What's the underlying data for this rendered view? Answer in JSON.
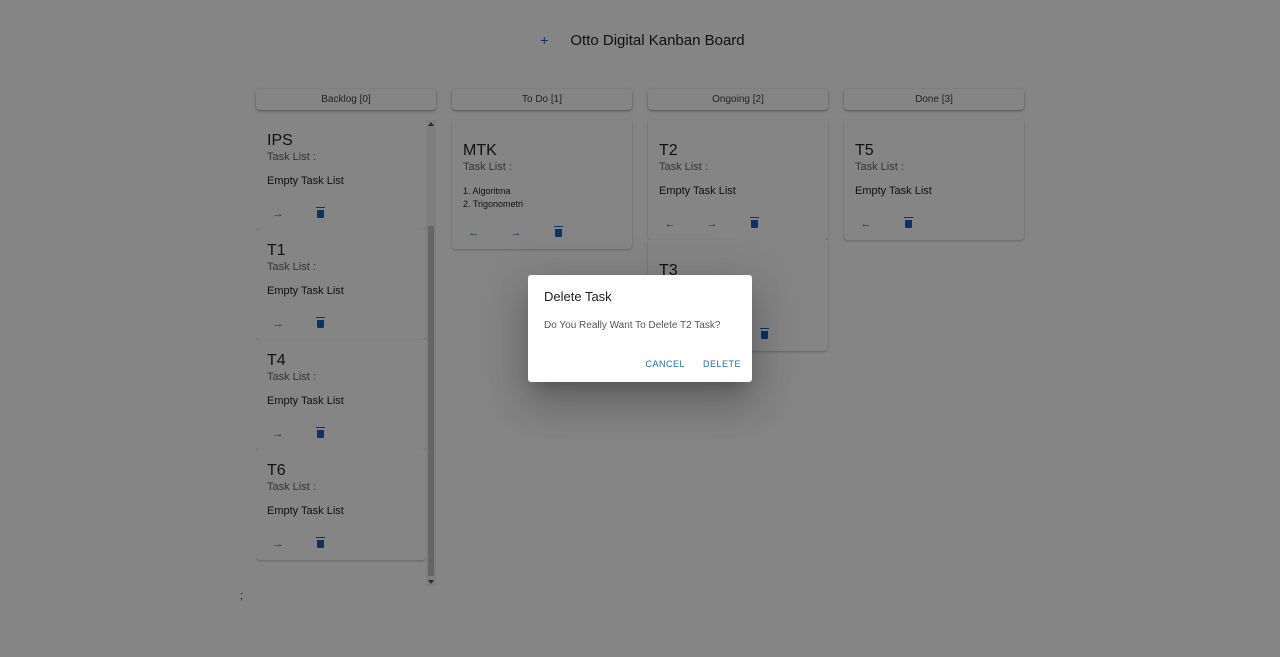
{
  "header": {
    "add_symbol": "+",
    "title": "Otto Digital Kanban Board"
  },
  "columns": [
    {
      "header": "Backlog [0]",
      "cards": [
        {
          "title": "IPS",
          "subtitle": "Task List :",
          "body": "Empty Task List",
          "actions": [
            "forward",
            "delete"
          ]
        },
        {
          "title": "T1",
          "subtitle": "Task List :",
          "body": "Empty Task List",
          "actions": [
            "forward",
            "delete"
          ]
        },
        {
          "title": "T4",
          "subtitle": "Task List :",
          "body": "Empty Task List",
          "actions": [
            "forward",
            "delete"
          ]
        },
        {
          "title": "T6",
          "subtitle": "Task List :",
          "body": "Empty Task List",
          "actions": [
            "forward",
            "delete"
          ]
        }
      ]
    },
    {
      "header": "To Do [1]",
      "cards": [
        {
          "title": "MTK",
          "subtitle": "Task List :",
          "tasks": [
            "1. Algoritma",
            "2. Trigonometri"
          ],
          "actions": [
            "back",
            "forward",
            "delete"
          ]
        }
      ]
    },
    {
      "header": "Ongoing [2]",
      "cards": [
        {
          "title": "T2",
          "subtitle": "Task List :",
          "body": "Empty Task List",
          "actions": [
            "back",
            "forward",
            "delete"
          ]
        },
        {
          "title": "T3",
          "subtitle": "",
          "body": "",
          "actions": [
            "delete"
          ]
        }
      ]
    },
    {
      "header": "Done [3]",
      "cards": [
        {
          "title": "T5",
          "subtitle": "Task List :",
          "body": "Empty Task List",
          "actions": [
            "back",
            "delete"
          ]
        }
      ]
    }
  ],
  "footer_text": ";",
  "dialog": {
    "title": "Delete Task",
    "message": "Do You Really Want To Delete T2 Task?",
    "cancel_label": "CANCEL",
    "delete_label": "DELETE"
  },
  "icons": {
    "forward": "arrow-right-icon",
    "back": "arrow-left-icon",
    "delete": "trash-icon"
  },
  "colors": {
    "accent": "#1565c0",
    "dialog_button": "#1e6fa3",
    "overlay": "rgba(0,0,0,0.48)"
  }
}
